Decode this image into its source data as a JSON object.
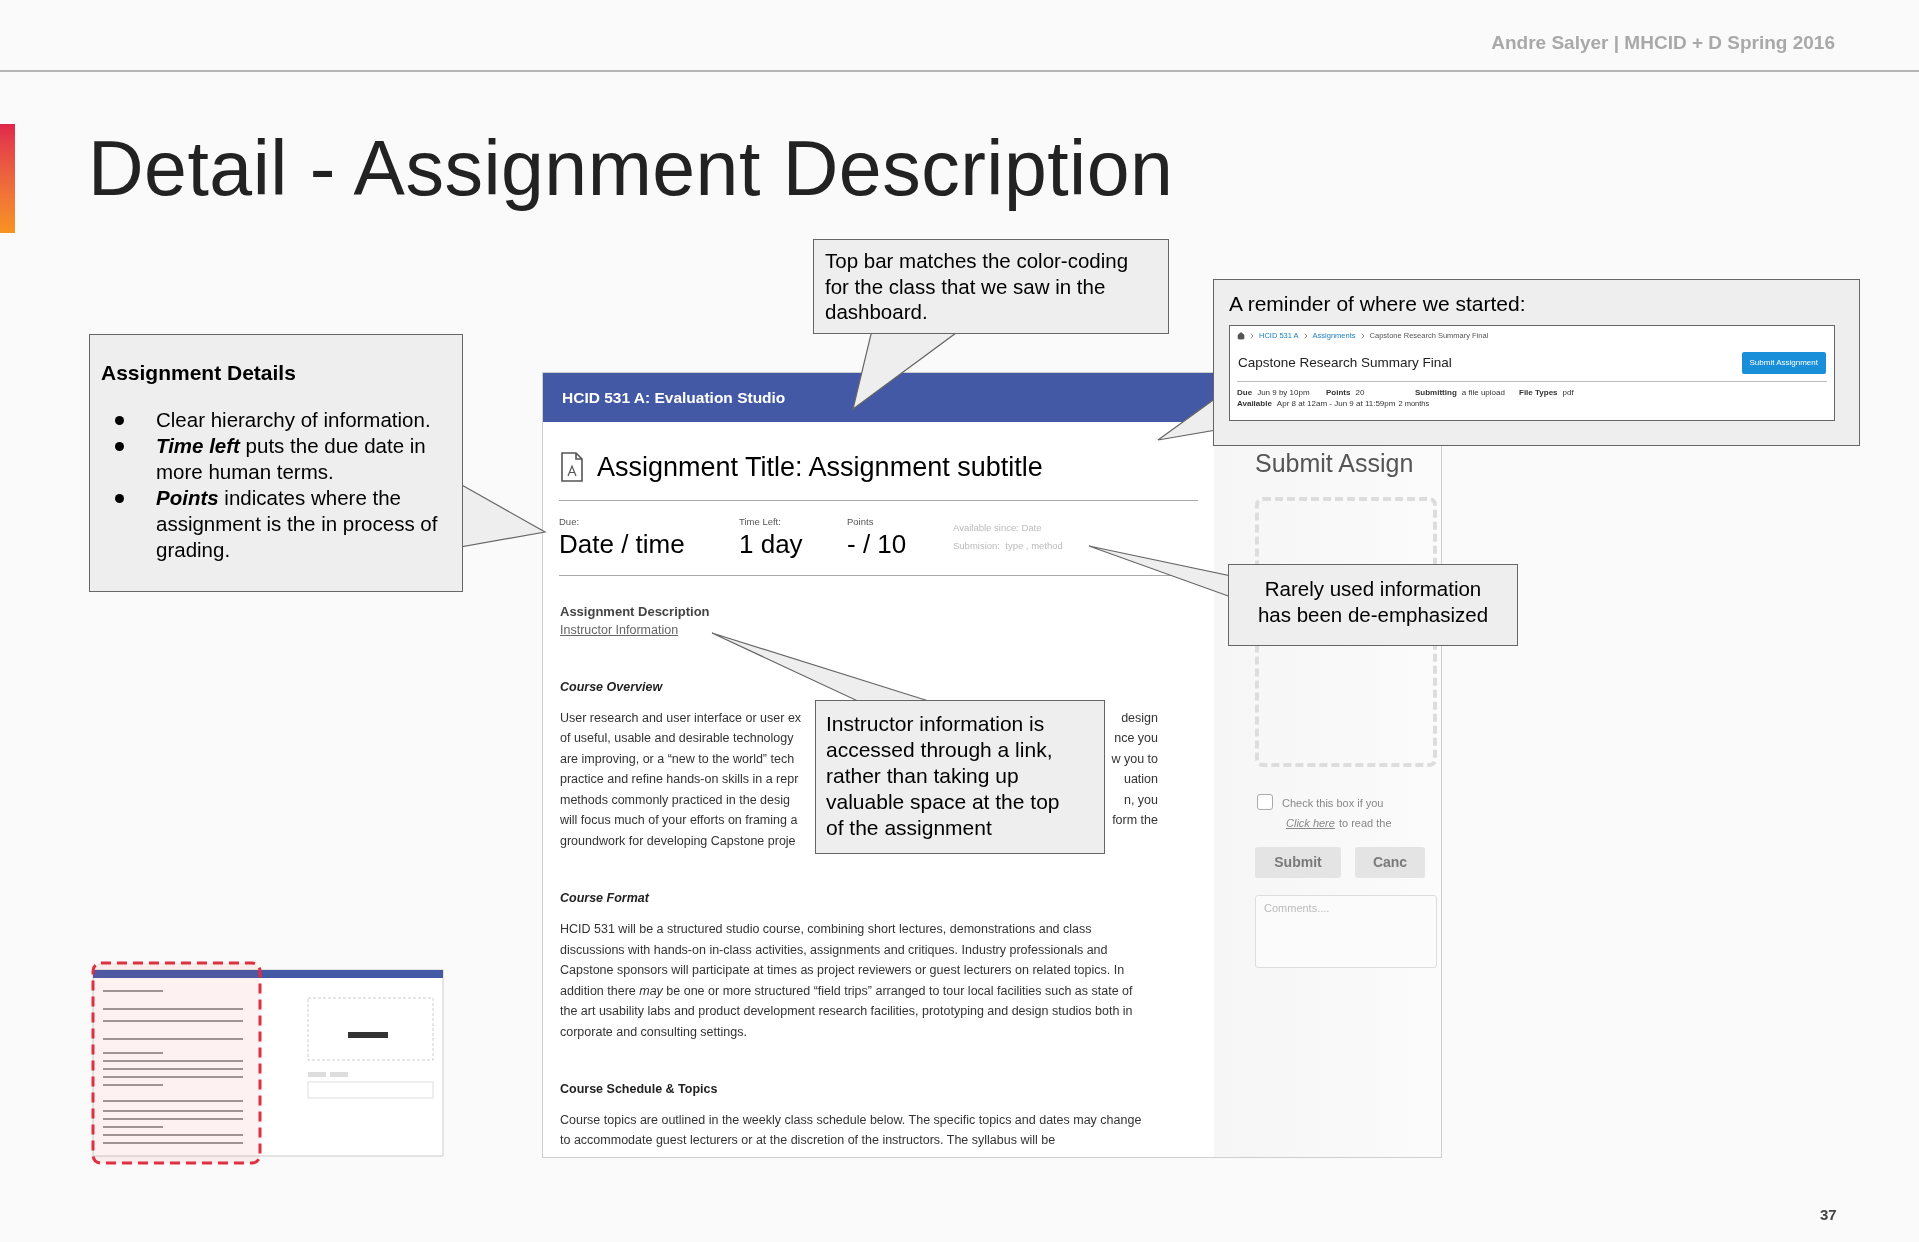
{
  "header": {
    "author": "Andre Salyer | MHCID + D Spring 2016"
  },
  "slide": {
    "title": "Detail - Assignment Description",
    "page_number": "37"
  },
  "mockup": {
    "course_bar": "HCID 531 A: Evaluation Studio",
    "assignment_title": "Assignment Title: Assignment subtitle",
    "meta": [
      {
        "label": "Due:",
        "value": "Date / time"
      },
      {
        "label": "Time Left:",
        "value": "1 day"
      },
      {
        "label": "Points",
        "value": "- / 10"
      }
    ],
    "secondary_meta": [
      "Available since: Date",
      "Submision:  type , method"
    ],
    "description_heading": "Assignment Description",
    "instructor_link": "Instructor Information",
    "sections": [
      {
        "heading": "Course Overview",
        "italic": true,
        "kind": "split_lines",
        "lines": [
          {
            "left": "User research and user interface or user ex",
            "right": "design"
          },
          {
            "left": "of useful, usable and desirable technology",
            "right": "nce you"
          },
          {
            "left": "are improving, or a “new to the world” tech",
            "right": "w you to"
          },
          {
            "left": "practice and refine hands-on skills in a repr",
            "right": "uation"
          },
          {
            "left": "methods commonly practiced in the desig",
            "right": "n, you"
          },
          {
            "left": "will focus much of your efforts on framing a",
            "right": "form the"
          },
          {
            "left": "groundwork for developing Capstone proje"
          }
        ]
      },
      {
        "heading": "Course Format",
        "italic": true,
        "kind": "paragraph",
        "text": "HCID 531 will be a structured studio course, combining short lectures, demonstrations and class discussions with hands-on in-class activities, assignments and critiques. Industry professionals and Capstone sponsors will participate at times as project reviewers or guest lecturers on related topics. In addition there *may* be one or more structured “field trips” arranged to tour local facilities such as state of the art usability labs and product development research facilities, prototyping and design studios both in corporate and consulting settings."
      },
      {
        "heading": "Course Schedule & Topics",
        "italic": false,
        "kind": "paragraph",
        "text": "Course topics are outlined in the weekly class schedule below. The specific topics and dates may change to accommodate guest lecturers or at the discretion of the instructors. The syllabus will be"
      }
    ]
  },
  "submit_panel": {
    "title": "Submit Assign",
    "agree": {
      "checked": false,
      "text": "Check this box if you"
    },
    "terms": {
      "link": "Click here",
      "text": "to read the"
    },
    "buttons": [
      {
        "label": "Submit",
        "disabled": true
      },
      {
        "label": "Canc",
        "disabled": true
      }
    ],
    "comments_placeholder": "Comments...."
  },
  "callouts": {
    "top_bar": {
      "text": "Top bar matches the color-coding for the class that we saw in the dashboard."
    },
    "reminder": {
      "heading": "A reminder of where we started:",
      "breadcrumbs": [
        {
          "label": "HCID 531 A",
          "link": true
        },
        {
          "label": "Assignments",
          "link": true
        },
        {
          "label": "Capstone Research Summary Final",
          "link": false
        }
      ],
      "title": "Capstone Research Summary Final",
      "button": "Submit Assignment",
      "details": [
        {
          "label": "Due",
          "value": "Jun 9 by 10pm"
        },
        {
          "label": "Points",
          "value": "20"
        },
        {
          "label": "Submitting",
          "value": "a file upload"
        },
        {
          "label": "File Types",
          "value": "pdf"
        }
      ],
      "available": {
        "label": "Available",
        "value": "Apr 8 at 12am - Jun 9 at 11:59pm",
        "note": "2 months"
      }
    },
    "details": {
      "title": "Assignment Details",
      "bullets": [
        "Clear hierarchy of information.",
        "**Time left** puts the due date in more human terms.",
        "**Points** indicates where the assignment is the in process of grading."
      ]
    },
    "rarely": {
      "text": "Rarely used information has been de-emphasized"
    },
    "instructor": {
      "text": "Instructor information is accessed through a link, rather than taking up valuable space at the top of the assignment"
    }
  }
}
